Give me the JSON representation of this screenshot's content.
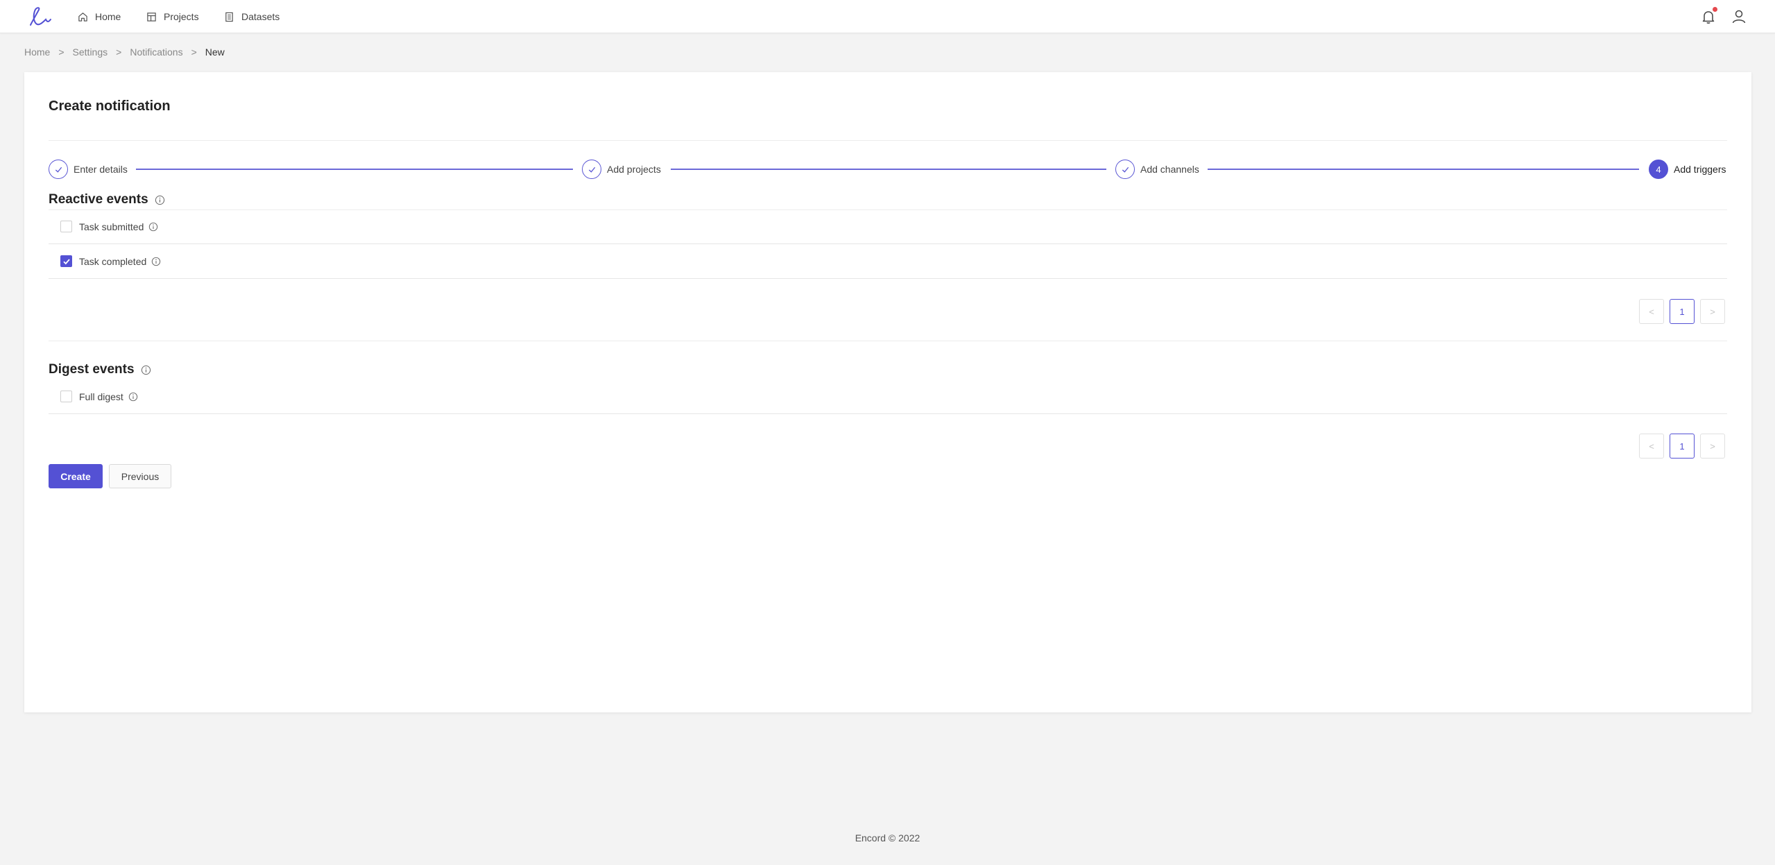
{
  "nav": {
    "items": [
      {
        "label": "Home",
        "icon": "home-icon"
      },
      {
        "label": "Projects",
        "icon": "projects-icon"
      },
      {
        "label": "Datasets",
        "icon": "datasets-icon"
      }
    ]
  },
  "breadcrumb": {
    "items": [
      "Home",
      "Settings",
      "Notifications",
      "New"
    ],
    "separator": ">"
  },
  "page": {
    "title": "Create notification"
  },
  "steps": [
    {
      "label": "Enter details",
      "status": "done"
    },
    {
      "label": "Add projects",
      "status": "done"
    },
    {
      "label": "Add channels",
      "status": "done"
    },
    {
      "label": "Add triggers",
      "status": "active",
      "number": "4"
    }
  ],
  "reactive": {
    "title": "Reactive events",
    "items": [
      {
        "label": "Task submitted",
        "checked": false
      },
      {
        "label": "Task completed",
        "checked": true
      }
    ],
    "pagination": {
      "current": "1",
      "prev": "<",
      "next": ">"
    }
  },
  "digest": {
    "title": "Digest events",
    "items": [
      {
        "label": "Full digest",
        "checked": false
      }
    ],
    "pagination": {
      "current": "1",
      "prev": "<",
      "next": ">"
    }
  },
  "actions": {
    "create_label": "Create",
    "previous_label": "Previous"
  },
  "footer": {
    "text": "Encord © 2022"
  },
  "colors": {
    "accent": "#5451d4",
    "notification_dot": "#e5484d",
    "background": "#f3f3f3"
  }
}
